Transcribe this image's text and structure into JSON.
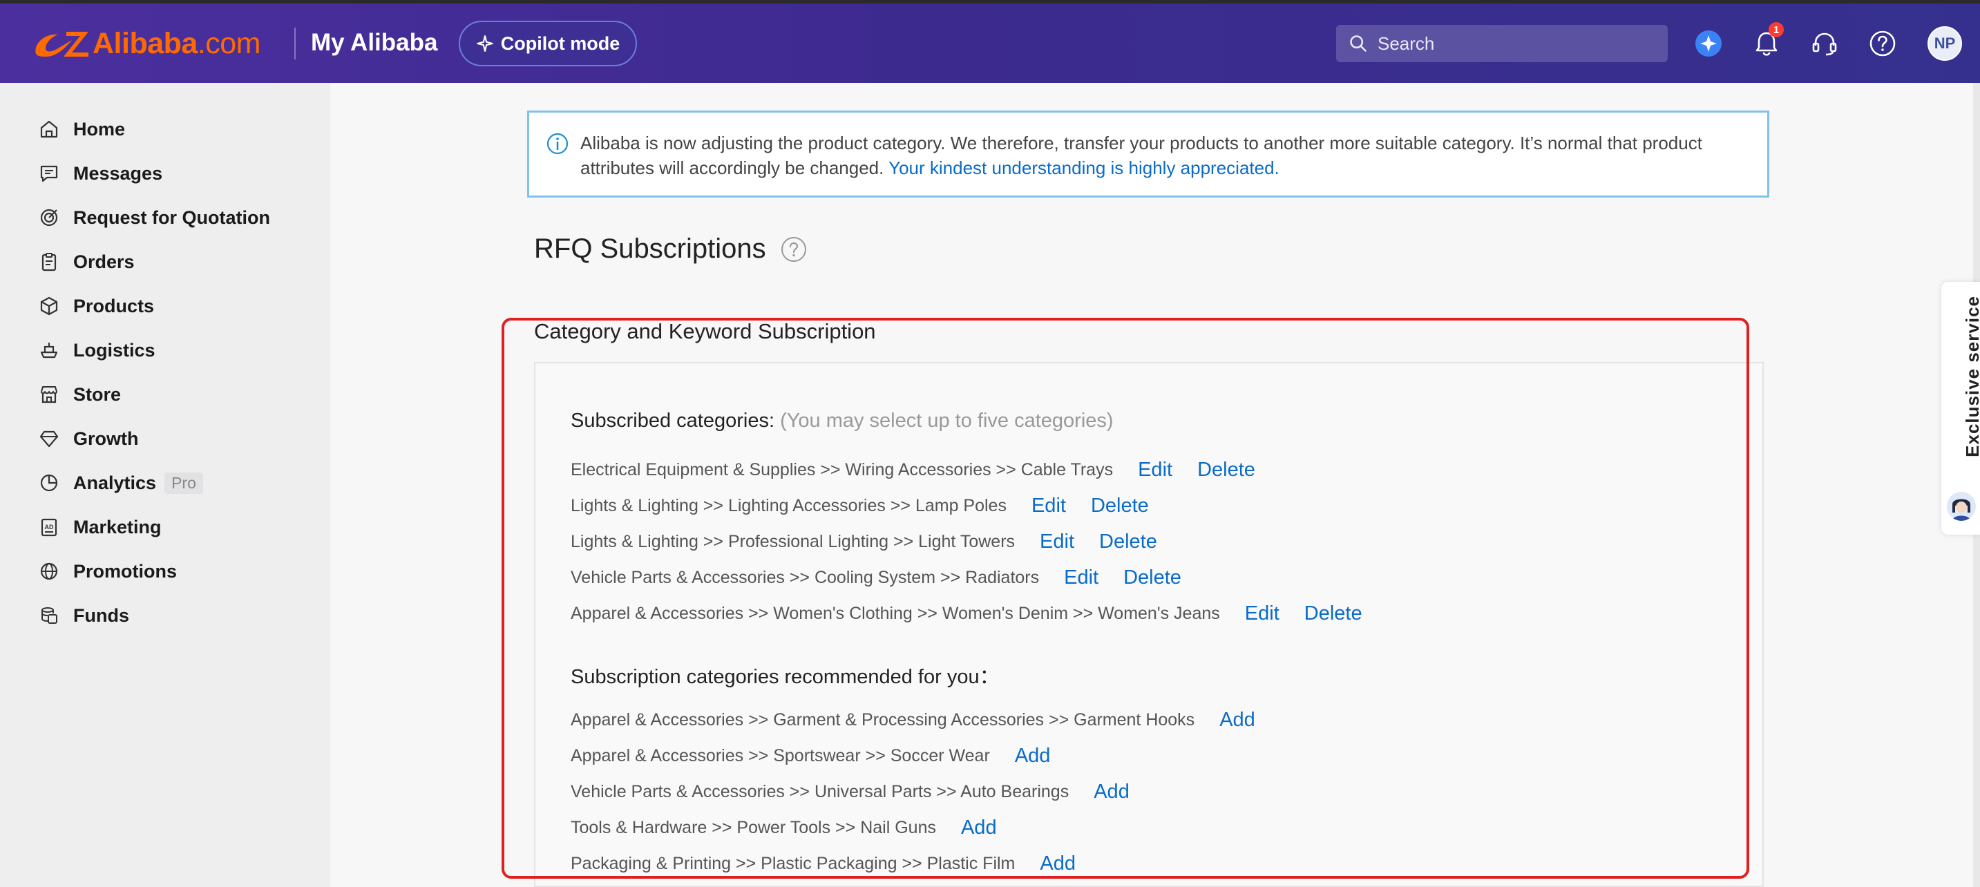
{
  "header": {
    "logo_text": "Alibaba",
    "logo_suffix": ".com",
    "app_title": "My Alibaba",
    "copilot_label": "Copilot mode",
    "search_placeholder": "Search",
    "notification_count": "1",
    "avatar_initials": "NP"
  },
  "sidebar": {
    "items": [
      {
        "label": "Home",
        "icon": "home-icon"
      },
      {
        "label": "Messages",
        "icon": "message-icon"
      },
      {
        "label": "Request for Quotation",
        "icon": "rfq-icon"
      },
      {
        "label": "Orders",
        "icon": "clipboard-icon"
      },
      {
        "label": "Products",
        "icon": "box-icon"
      },
      {
        "label": "Logistics",
        "icon": "ship-icon"
      },
      {
        "label": "Store",
        "icon": "store-icon"
      },
      {
        "label": "Growth",
        "icon": "diamond-icon"
      },
      {
        "label": "Analytics",
        "icon": "pie-chart-icon",
        "badge": "Pro"
      },
      {
        "label": "Marketing",
        "icon": "ad-icon"
      },
      {
        "label": "Promotions",
        "icon": "globe-icon"
      },
      {
        "label": "Funds",
        "icon": "coins-icon"
      }
    ]
  },
  "notice": {
    "text": "Alibaba is now adjusting the product category. We therefore, transfer your products to another more suitable category. It’s normal that product attributes will accordingly be changed. ",
    "link": "Your kindest understanding is highly appreciated."
  },
  "page": {
    "title": "RFQ Subscriptions",
    "section_title": "Category and Keyword Subscription",
    "subscribed_heading": "Subscribed categories:",
    "subscribed_hint": "(You may select up to five categories)",
    "subscribed": [
      "Electrical Equipment & Supplies >> Wiring Accessories >> Cable Trays",
      "Lights & Lighting >> Lighting Accessories >> Lamp Poles",
      "Lights & Lighting >> Professional Lighting >> Light Towers",
      "Vehicle Parts & Accessories >> Cooling System >> Radiators",
      "Apparel & Accessories >> Women's Clothing >> Women's Denim >> Women's Jeans"
    ],
    "edit_label": "Edit",
    "delete_label": "Delete",
    "recommended_heading": "Subscription categories recommended for you：",
    "recommended": [
      "Apparel & Accessories >> Garment & Processing Accessories >> Garment Hooks",
      "Apparel & Accessories >> Sportswear >> Soccer Wear",
      "Vehicle Parts & Accessories >> Universal Parts >> Auto Bearings",
      "Tools & Hardware >> Power Tools >> Nail Guns",
      "Packaging & Printing >> Plastic Packaging >> Plastic Film"
    ],
    "add_label": "Add"
  },
  "floating": {
    "exclusive_service": "Exclusive service"
  },
  "colors": {
    "header_bg": "#3d2a8f",
    "brand_orange": "#ff6a00",
    "link_blue": "#0a6bc8",
    "highlight_red": "#e02020",
    "notice_border": "#7fc3ea"
  }
}
